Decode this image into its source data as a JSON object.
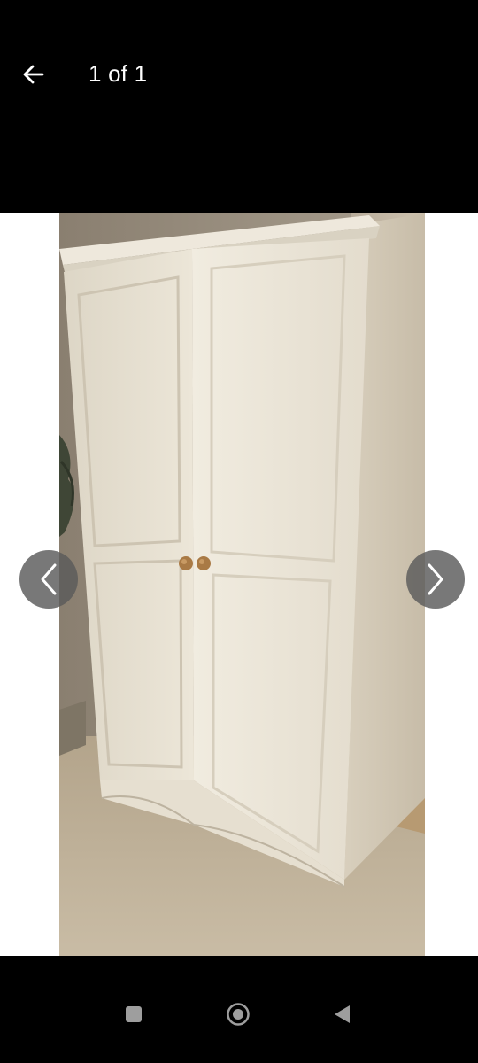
{
  "header": {
    "page_counter": "1 of 1",
    "back_icon": "arrow-left-icon",
    "background": "#000000",
    "text_color": "#ffffff"
  },
  "viewer": {
    "image_description_icon": "wardrobe-photo",
    "prev_icon": "chevron-left-icon",
    "next_icon": "chevron-right-icon",
    "nav_button_color": "#5a5a5a"
  },
  "system_nav": {
    "recents_icon": "square-icon",
    "home_icon": "circle-icon",
    "back_icon": "triangle-back-icon",
    "icon_color": "#9e9e9e"
  }
}
